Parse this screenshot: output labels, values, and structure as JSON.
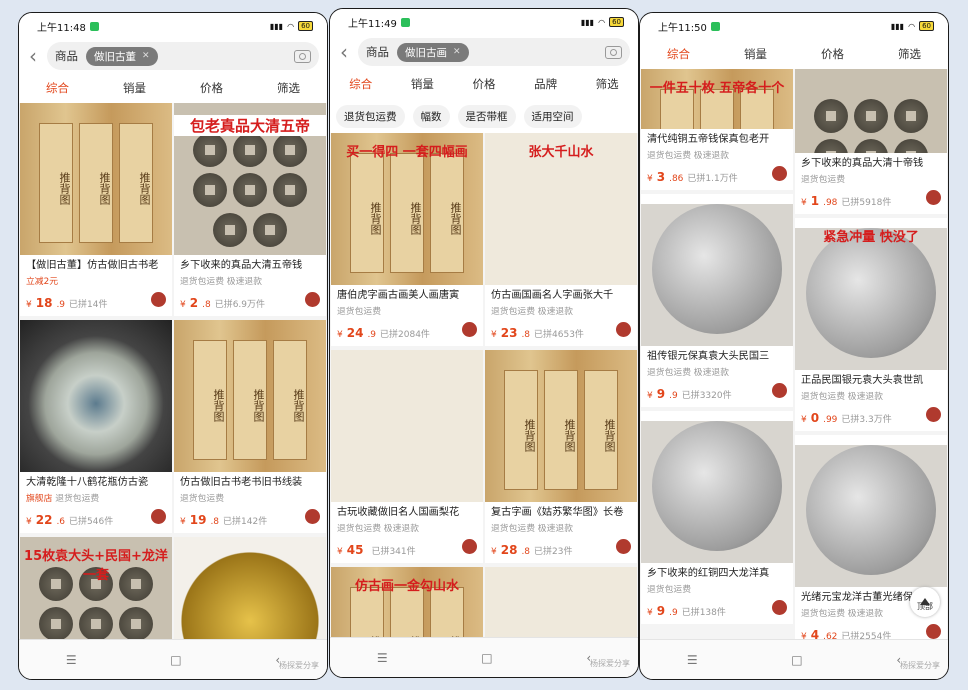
{
  "phones": [
    {
      "time": "上午11:48",
      "battery": "60",
      "category": "商品",
      "query": "做旧古董",
      "sort": [
        "综合",
        "销量",
        "价格",
        "筛选"
      ],
      "left": [
        {
          "title": "【做旧古董】仿古做旧古书老",
          "tag": "立减2元",
          "tag2": "",
          "price": "18",
          "dec": ".9",
          "sold": "已拼14件",
          "h": 152,
          "img": "paper",
          "overlay": ""
        },
        {
          "title": "大清乾隆十八鹤花瓶仿古瓷",
          "tag": "旗舰店",
          "tag2": "退货包运费",
          "price": "22",
          "dec": ".6",
          "sold": "已拼546件",
          "h": 152,
          "img": "bowl",
          "overlay": ""
        },
        {
          "title": "",
          "tag": "",
          "tag2": "",
          "price": "",
          "dec": "",
          "sold": "",
          "h": 120,
          "img": "coins",
          "overlay": "15枚袁大头+民国+龙洋一套"
        }
      ],
      "right": [
        {
          "title": "乡下收来的真品大清五帝钱",
          "tag": "退货包运费",
          "tag2": "极速退款",
          "price": "2",
          "dec": ".8",
          "sold": "已拼6.9万件",
          "h": 152,
          "img": "coins",
          "overlay": "包老真品大清五帝"
        },
        {
          "title": "仿古做旧古书老书旧书线装",
          "tag": "退货包运费",
          "tag2": "",
          "price": "19",
          "dec": ".8",
          "sold": "已拼142件",
          "h": 152,
          "img": "paper",
          "overlay": ""
        },
        {
          "title": "",
          "tag": "",
          "tag2": "",
          "price": "",
          "dec": "",
          "sold": "",
          "h": 120,
          "img": "gold",
          "overlay": ""
        }
      ],
      "watermark": "杨探爱分享"
    },
    {
      "time": "上午11:49",
      "battery": "60",
      "category": "商品",
      "query": "做旧古画",
      "sort": [
        "综合",
        "销量",
        "价格",
        "品牌",
        "筛选"
      ],
      "filters": [
        "退货包运费",
        "幅数",
        "是否带框",
        "适用空间"
      ],
      "left": [
        {
          "title": "唐伯虎字画古画美人画唐寅",
          "tag": "退货包运费",
          "tag2": "",
          "price": "24",
          "dec": ".9",
          "sold": "已拼2084件",
          "h": 152,
          "img": "paper",
          "overlay": "买一得四 一套四幅画"
        },
        {
          "title": "古玩收藏做旧名人国画梨花",
          "tag": "退货包运费",
          "tag2": "极速退款",
          "price": "45",
          "dec": "",
          "sold": "已拼341件",
          "h": 152,
          "img": "scroll",
          "overlay": ""
        },
        {
          "title": "",
          "tag": "",
          "tag2": "",
          "price": "",
          "dec": "",
          "sold": "",
          "h": 80,
          "img": "paper",
          "overlay": "仿古画一金勾山水"
        }
      ],
      "right": [
        {
          "title": "仿古画国画名人字画张大千",
          "tag": "退货包运费",
          "tag2": "极速退款",
          "price": "23",
          "dec": ".8",
          "sold": "已拼4653件",
          "h": 152,
          "img": "scroll",
          "overlay": "张大千山水"
        },
        {
          "title": "复古字画《姑苏繁华图》长卷",
          "tag": "退货包运费",
          "tag2": "极速退款",
          "price": "28",
          "dec": ".8",
          "sold": "已拼23件",
          "h": 152,
          "img": "paper",
          "overlay": ""
        },
        {
          "title": "",
          "tag": "",
          "tag2": "",
          "price": "",
          "dec": "",
          "sold": "",
          "h": 80,
          "img": "scroll",
          "overlay": ""
        }
      ],
      "watermark": "杨探爱分享"
    },
    {
      "time": "上午11:50",
      "battery": "60",
      "category": "",
      "query": "",
      "sort": [
        "综合",
        "销量",
        "价格",
        "筛选"
      ],
      "left": [
        {
          "title": "清代纯铜五帝钱保真包老开",
          "tag": "退货包运费",
          "tag2": "极速退款",
          "price": "3",
          "dec": ".86",
          "sold": "已拼1.1万件",
          "h": 60,
          "img": "paper",
          "overlay": "一件五十枚 五帝各十个"
        },
        {
          "title": "祖传银元保真袁大头民国三",
          "tag": "退货包运费",
          "tag2": "极速退款",
          "price": "9",
          "dec": ".9",
          "sold": "已拼3320件",
          "h": 152,
          "img": "silver",
          "overlay": ""
        },
        {
          "title": "乡下收来的红铜四大龙洋真",
          "tag": "退货包运费",
          "tag2": "",
          "price": "9",
          "dec": ".9",
          "sold": "已拼138件",
          "h": 152,
          "img": "silver",
          "overlay": ""
        }
      ],
      "right": [
        {
          "title": "乡下收来的真品大清十帝钱",
          "tag": "退货包运费",
          "tag2": "",
          "price": "1",
          "dec": ".98",
          "sold": "已拼5918件",
          "h": 84,
          "img": "coins",
          "overlay": ""
        },
        {
          "title": "正品民国银元袁大头袁世凯",
          "tag": "退货包运费",
          "tag2": "极速退款",
          "price": "0",
          "dec": ".99",
          "sold": "已拼3.3万件",
          "h": 152,
          "img": "silver",
          "overlay": "紧急冲量 快没了"
        },
        {
          "title": "光绪元宝龙洋古董光绪保真",
          "tag": "退货包运费",
          "tag2": "极速退款",
          "price": "4",
          "dec": ".62",
          "sold": "已拼2554件",
          "h": 152,
          "img": "silver",
          "overlay": ""
        }
      ],
      "top_button": "顶部",
      "watermark": "杨探爱分享"
    }
  ]
}
